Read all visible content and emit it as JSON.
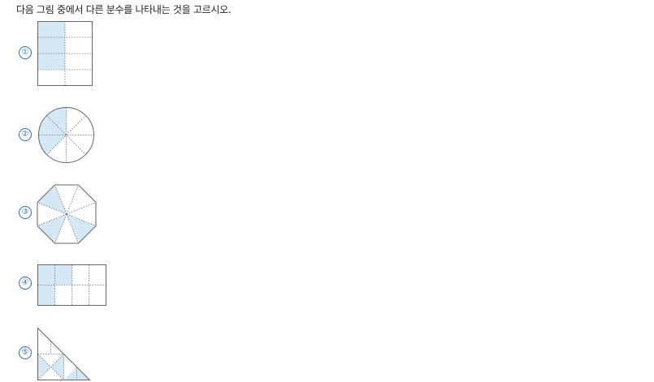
{
  "question": "다음 그림 중에서 다른 분수를 나타내는 것을 고르시오.",
  "choices": [
    {
      "label": "①",
      "shape": "rectangle",
      "parts": 8,
      "shaded": 3
    },
    {
      "label": "②",
      "shape": "circle",
      "parts": 8,
      "shaded": 3
    },
    {
      "label": "③",
      "shape": "octagon",
      "parts": 8,
      "shaded": 3
    },
    {
      "label": "④",
      "shape": "rectangle",
      "parts": 8,
      "shaded": 3
    },
    {
      "label": "⑤",
      "shape": "right-triangle",
      "parts": 8,
      "shaded": 3
    }
  ],
  "colors": {
    "shade": "#d4e8f6",
    "outline": "#666666",
    "number": "#2a6ab8"
  }
}
